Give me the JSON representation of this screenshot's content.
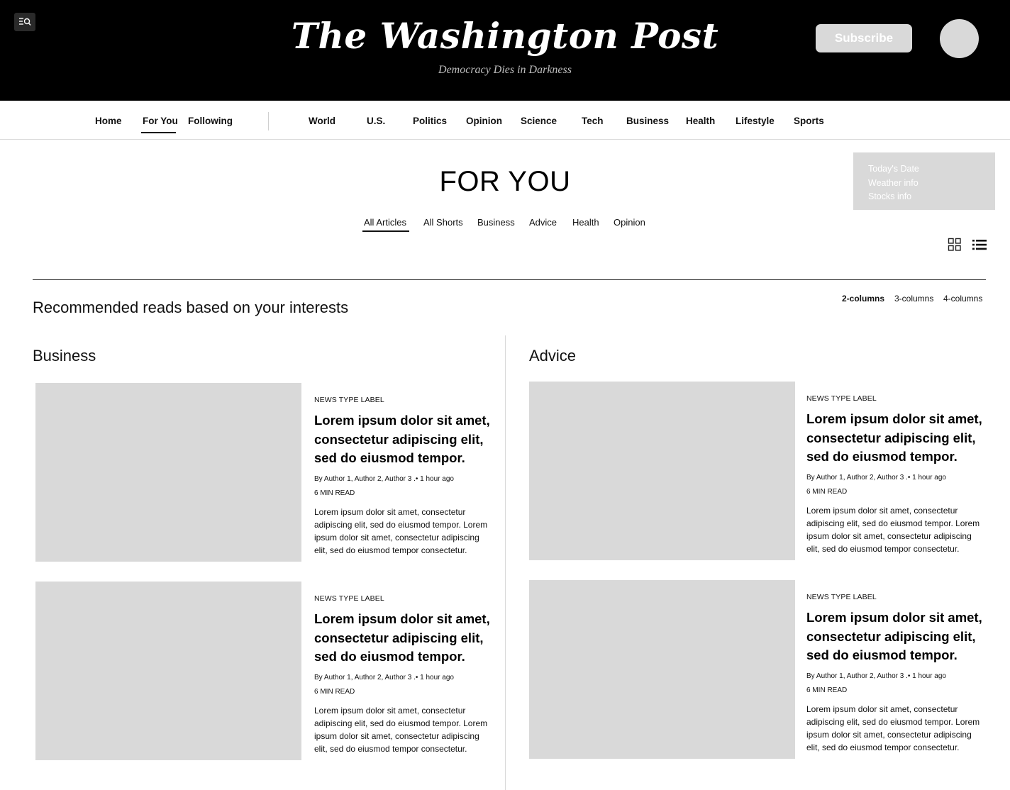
{
  "header": {
    "logo": "The Washington Post",
    "tagline": "Democracy Dies in Darkness",
    "subscribe_label": "Subscribe",
    "menu_icon": "menu-search-icon",
    "avatar_icon": "avatar"
  },
  "nav": {
    "items": [
      "Home",
      "For You",
      "Following",
      "World",
      "U.S.",
      "Politics",
      "Opinion",
      "Science",
      "Tech",
      "Business",
      "Health",
      "Lifestyle",
      "Sports"
    ],
    "active": "For You"
  },
  "page": {
    "title": "FOR YOU",
    "tabs": [
      "All Articles",
      "All Shorts",
      "Business",
      "Advice",
      "Health",
      "Opinion"
    ],
    "active_tab": "All Articles"
  },
  "info_box": {
    "date": "Today's Date",
    "weather": "Weather info",
    "stocks": "Stocks info"
  },
  "view_toggle": {
    "grid_icon": "grid-view-icon",
    "list_icon": "list-view-icon"
  },
  "recommended": {
    "heading": "Recommended reads based on your interests",
    "column_options": [
      "2-columns",
      "3-columns",
      "4-columns"
    ],
    "active_option": "2-columns"
  },
  "sections": [
    {
      "name": "Business",
      "articles": [
        {
          "label": "NEWS TYPE LABEL",
          "title": "Lorem ipsum dolor sit amet, consectetur adipiscing elit, sed do eiusmod tempor.",
          "meta": "By Author 1, Author 2, Author 3  .•  1 hour ago",
          "read_time": "6 MIN READ",
          "description": "Lorem ipsum dolor sit amet, consectetur adipiscing elit, sed do eiusmod tempor. Lorem ipsum dolor sit amet, consectetur adipiscing elit, sed do eiusmod tempor consectetur."
        },
        {
          "label": "NEWS TYPE LABEL",
          "title": "Lorem ipsum dolor sit amet, consectetur adipiscing elit, sed do eiusmod tempor.",
          "meta": "By Author 1, Author 2, Author 3  .•  1 hour ago",
          "read_time": "6 MIN READ",
          "description": "Lorem ipsum dolor sit amet, consectetur adipiscing elit, sed do eiusmod tempor. Lorem ipsum dolor sit amet, consectetur adipiscing elit, sed do eiusmod tempor consectetur."
        }
      ]
    },
    {
      "name": "Advice",
      "articles": [
        {
          "label": "NEWS TYPE LABEL",
          "title": "Lorem ipsum dolor sit amet, consectetur adipiscing elit, sed do eiusmod tempor.",
          "meta": "By Author 1, Author 2, Author 3  .•  1 hour ago",
          "read_time": "6 MIN READ",
          "description": "Lorem ipsum dolor sit amet, consectetur adipiscing elit, sed do eiusmod tempor. Lorem ipsum dolor sit amet, consectetur adipiscing elit, sed do eiusmod tempor consectetur."
        },
        {
          "label": "NEWS TYPE LABEL",
          "title": "Lorem ipsum dolor sit amet, consectetur adipiscing elit, sed do eiusmod tempor.",
          "meta": "By Author 1, Author 2, Author 3  .•  1 hour ago",
          "read_time": "6 MIN READ",
          "description": "Lorem ipsum dolor sit amet, consectetur adipiscing elit, sed do eiusmod tempor. Lorem ipsum dolor sit amet, consectetur adipiscing elit, sed do eiusmod tempor consectetur."
        }
      ]
    }
  ],
  "colors": {
    "masthead": "#000000",
    "placeholder": "#d9d9d9",
    "text": "#111111"
  }
}
